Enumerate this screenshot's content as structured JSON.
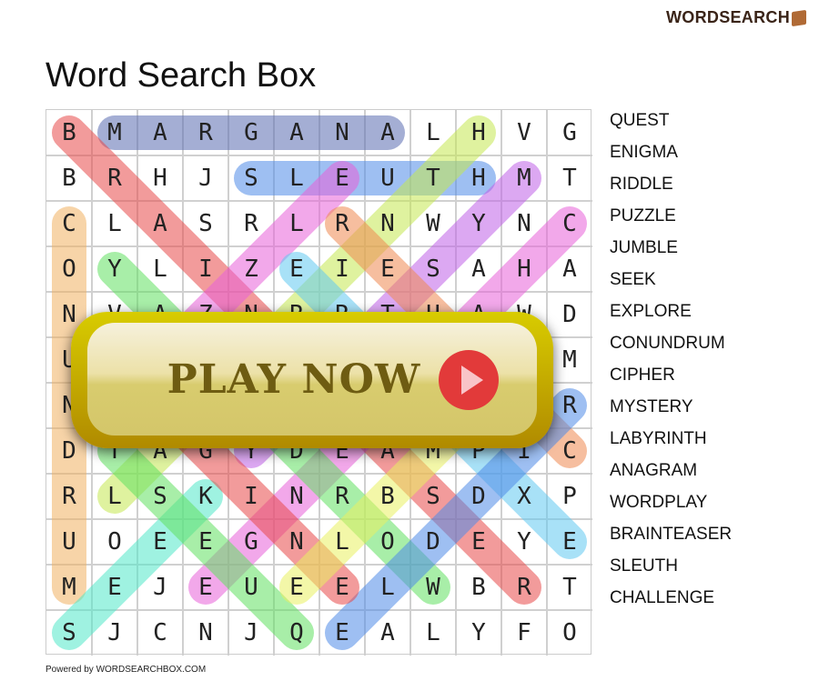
{
  "logo": {
    "text": "WORDSEARCH",
    "icon": "box-icon"
  },
  "title": "Word Search Box",
  "grid": [
    [
      "B",
      "M",
      "A",
      "R",
      "G",
      "A",
      "N",
      "A",
      "L",
      "H",
      "V",
      "G"
    ],
    [
      "B",
      "R",
      "H",
      "J",
      "S",
      "L",
      "E",
      "U",
      "T",
      "H",
      "M",
      "T"
    ],
    [
      "C",
      "L",
      "A",
      "S",
      "R",
      "L",
      "R",
      "N",
      "W",
      "Y",
      "N",
      "C"
    ],
    [
      "O",
      "Y",
      "L",
      "I",
      "Z",
      "E",
      "I",
      "E",
      "S",
      "A",
      "H",
      "A"
    ],
    [
      "N",
      "V",
      "A",
      "Z",
      "N",
      "R",
      "R",
      "T",
      "H",
      "A",
      "W",
      "D"
    ],
    [
      "U",
      "",
      "",
      "",
      "",
      "",
      "",
      "",
      "",
      "",
      "",
      "M"
    ],
    [
      "N",
      "",
      "",
      "",
      "",
      "",
      "",
      "",
      "",
      "",
      "",
      "R"
    ],
    [
      "D",
      "T",
      "A",
      "G",
      "Y",
      "D",
      "E",
      "A",
      "M",
      "P",
      "I",
      "C"
    ],
    [
      "R",
      "L",
      "S",
      "K",
      "I",
      "N",
      "R",
      "B",
      "S",
      "D",
      "X",
      "P"
    ],
    [
      "U",
      "O",
      "E",
      "E",
      "G",
      "N",
      "L",
      "O",
      "D",
      "E",
      "Y",
      "E"
    ],
    [
      "M",
      "E",
      "J",
      "E",
      "U",
      "E",
      "E",
      "L",
      "W",
      "B",
      "R",
      "T"
    ],
    [
      "S",
      "J",
      "C",
      "N",
      "J",
      "Q",
      "E",
      "A",
      "L",
      "Y",
      "F",
      "O"
    ]
  ],
  "found": [
    {
      "from": [
        0,
        1
      ],
      "to": [
        0,
        7
      ],
      "color": "#5a6cb0"
    },
    {
      "from": [
        1,
        4
      ],
      "to": [
        1,
        9
      ],
      "color": "#4f8ae8"
    },
    {
      "from": [
        2,
        0
      ],
      "to": [
        10,
        0
      ],
      "color": "#f0b060"
    },
    {
      "from": [
        0,
        0
      ],
      "to": [
        10,
        10
      ],
      "color": "#e84848"
    },
    {
      "from": [
        8,
        1
      ],
      "to": [
        0,
        9
      ],
      "color": "#c4e850"
    },
    {
      "from": [
        1,
        10
      ],
      "to": [
        7,
        4
      ],
      "color": "#c060e8"
    },
    {
      "from": [
        2,
        11
      ],
      "to": [
        10,
        3
      ],
      "color": "#e860d8"
    },
    {
      "from": [
        1,
        6
      ],
      "to": [
        6,
        1
      ],
      "color": "#e860d8"
    },
    {
      "from": [
        2,
        6
      ],
      "to": [
        7,
        11
      ],
      "color": "#ee8850"
    },
    {
      "from": [
        3,
        5
      ],
      "to": [
        9,
        11
      ],
      "color": "#60c8f0"
    },
    {
      "from": [
        3,
        1
      ],
      "to": [
        10,
        8
      ],
      "color": "#60e060"
    },
    {
      "from": [
        11,
        0
      ],
      "to": [
        8,
        3
      ],
      "color": "#50e8c8"
    },
    {
      "from": [
        11,
        5
      ],
      "to": [
        7,
        1
      ],
      "color": "#60e060"
    },
    {
      "from": [
        11,
        6
      ],
      "to": [
        6,
        11
      ],
      "color": "#4f8ae8"
    },
    {
      "from": [
        10,
        6
      ],
      "to": [
        5,
        1
      ],
      "color": "#e84848"
    },
    {
      "from": [
        10,
        5
      ],
      "to": [
        5,
        10
      ],
      "color": "#eaf060"
    }
  ],
  "words": [
    "QUEST",
    "ENIGMA",
    "RIDDLE",
    "PUZZLE",
    "JUMBLE",
    "SEEK",
    "EXPLORE",
    "CONUNDRUM",
    "CIPHER",
    "MYSTERY",
    "LABYRINTH",
    "ANAGRAM",
    "WORDPLAY",
    "BRAINTEASER",
    "SLEUTH",
    "CHALLENGE"
  ],
  "play_button": {
    "label": "PLAY NOW",
    "icon": "play-icon",
    "color": "#e23a3a"
  },
  "powered": "Powered by WORDSEARCHBOX.COM"
}
